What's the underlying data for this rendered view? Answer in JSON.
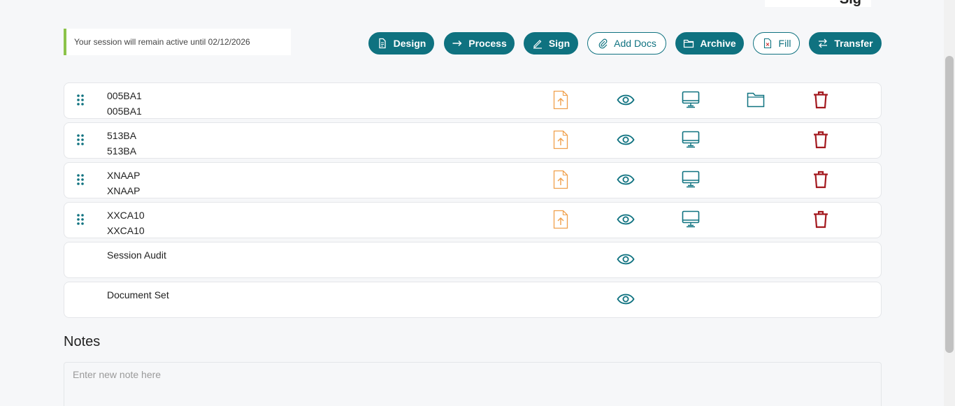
{
  "header": {
    "cut_text": "Sig"
  },
  "session": {
    "message": "Your session will remain active until 02/12/2026"
  },
  "toolbar": {
    "design": "Design",
    "process": "Process",
    "sign": "Sign",
    "add_docs": "Add Docs",
    "archive": "Archive",
    "fill": "Fill",
    "transfer": "Transfer"
  },
  "documents": [
    {
      "line1": "005BA1",
      "line2": "005BA1"
    },
    {
      "line1": "513BA",
      "line2": "513BA"
    },
    {
      "line1": "XNAAP",
      "line2": "XNAAP"
    },
    {
      "line1": "XXCA10",
      "line2": "XXCA10"
    },
    {
      "line1": "Session Audit",
      "line2": ""
    },
    {
      "line1": "Document Set",
      "line2": ""
    }
  ],
  "notes": {
    "title": "Notes",
    "placeholder": "Enter new note here"
  },
  "colors": {
    "primary": "#0f7280",
    "upload": "#f0a04b",
    "delete": "#a3181e",
    "session_accent": "#8cc34a"
  }
}
